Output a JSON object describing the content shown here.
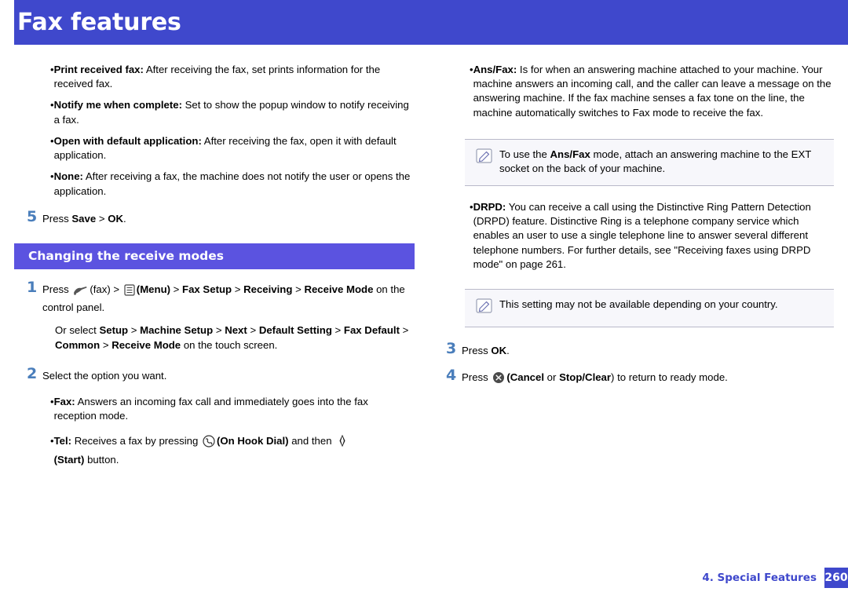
{
  "header": {
    "title": "Fax features"
  },
  "left": {
    "bullets": [
      {
        "bold": "Print received fax:",
        "text": " After receiving the fax, set prints information for the received fax."
      },
      {
        "bold": "Notify me when complete:",
        "text": "  Set to show the popup window to notify receiving a fax."
      },
      {
        "bold": "Open with default application:",
        "text": "  After receiving the fax, open it with default application."
      },
      {
        "bold": "None:",
        "text": "  After receiving a fax, the machine does not notify the user or opens the application."
      }
    ],
    "step5": {
      "num": "5",
      "pre": "Press ",
      "b1": "Save",
      "sep": " > ",
      "b2": "OK",
      "post": "."
    },
    "section_title": "Changing the receive modes",
    "step1": {
      "num": "1",
      "pre": "Press ",
      "fax_label": "(fax) >",
      "menu_label": "(Menu)",
      "path": " > Fax Setup > Receiving > Receive Mode",
      "path_parts": [
        "Fax Setup",
        "Receiving",
        "Receive Mode"
      ],
      "tail": " on the control panel.",
      "alt_pre": "Or select ",
      "alt_parts": [
        "Setup",
        "Machine Setup",
        "Next",
        "Default Setting",
        "Fax Default",
        "Common",
        "Receive Mode"
      ],
      "alt_tail": " on the touch screen."
    },
    "step2": {
      "num": "2",
      "text": "Select the option you want."
    },
    "step2_bullets": [
      {
        "bold": "Fax:",
        "text": " Answers an incoming fax call and immediately goes into the fax reception mode."
      },
      {
        "bold": "Tel:",
        "text": " Receives a fax by pressing ",
        "mid_bold": "(On Hook Dial)",
        "text2": " and then ",
        "tail_bold": "(Start)",
        "text3": " button."
      }
    ]
  },
  "right": {
    "bullets": [
      {
        "bold": "Ans/Fax:",
        "text": " Is for when an answering machine attached to your machine. Your machine answers an incoming call, and the caller can leave a message on the answering machine. If the fax machine senses a fax tone on the line, the machine automatically switches to Fax mode to receive the fax."
      }
    ],
    "note1": {
      "pre": "To use the ",
      "bold": "Ans/Fax",
      "post": " mode, attach an answering machine to the EXT socket on the back of your machine."
    },
    "bullet_drpd": {
      "bold": "DRPD:",
      "text": " You can receive a call using the Distinctive Ring Pattern Detection (DRPD) feature. Distinctive Ring is a telephone company service which enables an user to use a single telephone line to answer several different telephone numbers. For further details, see \"Receiving faxes using DRPD mode\" on page 261."
    },
    "note2": {
      "text": "This setting may not be available depending on your country."
    },
    "step3": {
      "num": "3",
      "pre": "Press ",
      "bold": "OK",
      "post": "."
    },
    "step4": {
      "num": "4",
      "pre": "Press ",
      "b1": "(Cancel",
      "mid": " or ",
      "b2": "Stop/Clear",
      "post": ") to return to ready mode."
    }
  },
  "footer": {
    "label": "4. Special Features",
    "page": "260"
  },
  "colors": {
    "header": "#3f48cc",
    "section": "#5b53e0",
    "step_num": "#4a7ebb"
  }
}
